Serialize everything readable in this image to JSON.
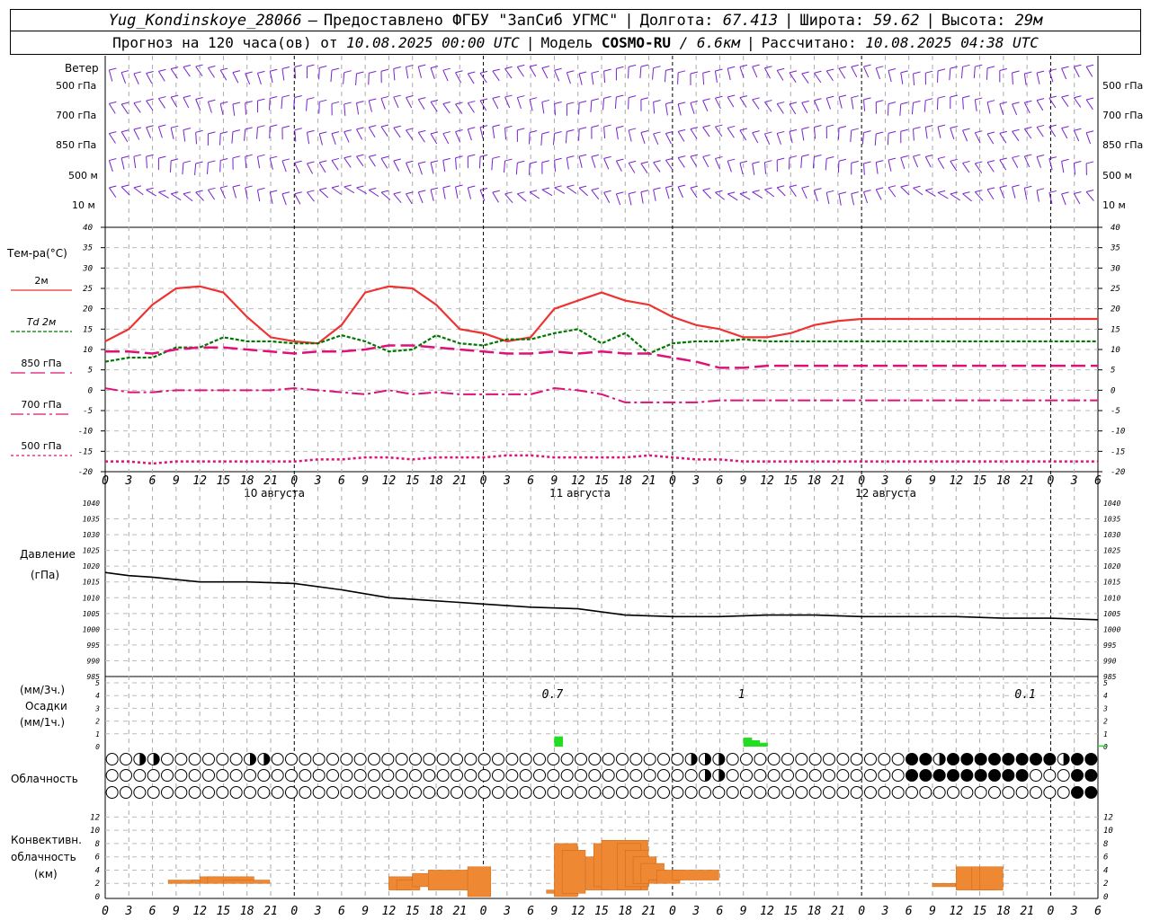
{
  "header": {
    "station": "Yug_Kondinskoye_28066",
    "dash": "–",
    "provided": "Предоставлено ФГБУ \"ЗапСиб УГМС\"",
    "lon_label": "Долгота:",
    "lon": "67.413",
    "lat_label": "Широта:",
    "lat": "59.62",
    "alt_label": "Высота:",
    "alt": "29м",
    "forecast_label": "Прогноз на 120 часа(ов) от",
    "forecast_date": "10.08.2025 00:00 UTC",
    "model_label": "Модель",
    "model": "COSMO-RU",
    "resolution": "/ 6.6км",
    "calc_label": "Рассчитано:",
    "calc_date": "10.08.2025 04:38 UTC"
  },
  "wind_panel": {
    "title": "Ветер",
    "levels": [
      "500 гПа",
      "700 гПа",
      "850 гПа",
      "500 м",
      "10 м"
    ]
  },
  "temp_panel": {
    "title": "Тем-ра(°C)",
    "legend": [
      {
        "label": "2м",
        "color": "#ee3333"
      },
      {
        "label": "Td  2м",
        "color": "#007700"
      },
      {
        "label": "850 гПа",
        "color": "#dd1177"
      },
      {
        "label": "700 гПа",
        "color": "#dd1177"
      },
      {
        "label": "500 гПа",
        "color": "#dd1177"
      }
    ]
  },
  "dates": [
    "10 августа",
    "11 августа",
    "12 августа"
  ],
  "pressure_panel": {
    "title1": "Давление",
    "title2": "(гПа)"
  },
  "precip_panel": {
    "title1": "(мм/3ч.)",
    "title2": "Осадки",
    "title3": "(мм/1ч.)",
    "annotations": [
      {
        "h": 57,
        "text": "0.7"
      },
      {
        "h": 81,
        "text": "1"
      },
      {
        "h": 117,
        "text": "0.1"
      }
    ]
  },
  "cloud_panel": {
    "title": "Облачность"
  },
  "conv_panel": {
    "title1": "Конвективн.",
    "title2": "облачность",
    "title3": "(км)"
  },
  "chart_data": [
    {
      "type": "line",
      "title": "Тем-ра(°C)",
      "x_hours": [
        0,
        3,
        6,
        9,
        12,
        15,
        18,
        21,
        24,
        27,
        30,
        33,
        36,
        39,
        42,
        45,
        48,
        51,
        54,
        57,
        60,
        63,
        66,
        69,
        72,
        75,
        78,
        81,
        84,
        87,
        90,
        93,
        96,
        99,
        102,
        105,
        108,
        111,
        114,
        117,
        120,
        123,
        126
      ],
      "ylim": [
        -20,
        40
      ],
      "series": [
        {
          "name": "2м",
          "values": [
            12,
            15,
            21,
            25,
            25.5,
            24,
            18,
            13,
            12,
            11.5,
            16,
            24,
            25.5,
            25,
            21,
            15,
            14,
            12,
            13,
            20,
            22,
            24,
            22,
            21,
            18,
            16,
            15,
            13,
            13,
            14,
            16,
            17,
            17.5,
            17.5,
            17.5,
            17.5,
            17.5,
            17.5,
            17.5,
            17.5,
            17.5,
            17.5,
            17.5
          ]
        },
        {
          "name": "Td 2м",
          "values": [
            7,
            8,
            8,
            10.5,
            10.5,
            13,
            12,
            12,
            11.5,
            11.5,
            13.5,
            12,
            9.5,
            10,
            13.5,
            11.5,
            11,
            12.5,
            12.5,
            14,
            15,
            11.5,
            14,
            9,
            11.5,
            12,
            12,
            12.5,
            12,
            12,
            12,
            12,
            12,
            12,
            12,
            12,
            12,
            12,
            12,
            12,
            12,
            12,
            12
          ]
        },
        {
          "name": "850 гПа",
          "values": [
            9.5,
            9.5,
            9,
            10,
            10.5,
            10.5,
            10,
            9.5,
            9,
            9.5,
            9.5,
            10,
            11,
            11,
            10.5,
            10,
            9.5,
            9,
            9,
            9.5,
            9,
            9.5,
            9,
            9,
            8,
            7,
            5.5,
            5.5,
            6,
            6,
            6,
            6,
            6,
            6,
            6,
            6,
            6,
            6,
            6,
            6,
            6,
            6,
            6
          ]
        },
        {
          "name": "700 гПа",
          "values": [
            0.5,
            -0.5,
            -0.5,
            0,
            0,
            0,
            0,
            0,
            0.5,
            0,
            -0.5,
            -1,
            0,
            -1,
            -0.5,
            -1,
            -1,
            -1,
            -1,
            0.5,
            0,
            -1,
            -3,
            -3,
            -3,
            -3,
            -2.5,
            -2.5,
            -2.5,
            -2.5,
            -2.5,
            -2.5,
            -2.5,
            -2.5,
            -2.5,
            -2.5,
            -2.5,
            -2.5,
            -2.5,
            -2.5,
            -2.5,
            -2.5,
            -2.5
          ]
        },
        {
          "name": "500 гПа",
          "values": [
            -17.5,
            -17.5,
            -18,
            -17.5,
            -17.5,
            -17.5,
            -17.5,
            -17.5,
            -17.5,
            -17,
            -17,
            -16.5,
            -16.5,
            -17,
            -16.5,
            -16.5,
            -16.5,
            -16,
            -16,
            -16.5,
            -16.5,
            -16.5,
            -16.5,
            -16,
            -16.5,
            -17,
            -17,
            -17.5,
            -17.5,
            -17.5,
            -17.5,
            -17.5,
            -17.5,
            -17.5,
            -17.5,
            -17.5,
            -17.5,
            -17.5,
            -17.5,
            -17.5,
            -17.5,
            -17.5,
            -17.5
          ]
        }
      ]
    },
    {
      "type": "line",
      "title": "Давление (гПа)",
      "x_hours": [
        0,
        3,
        6,
        12,
        18,
        24,
        30,
        36,
        42,
        48,
        54,
        60,
        66,
        72,
        78,
        84,
        90,
        96,
        102,
        108,
        114,
        120,
        126
      ],
      "ylim": [
        985,
        1040
      ],
      "series": [
        {
          "name": "Давление",
          "values": [
            1018,
            1017,
            1016.5,
            1015,
            1015,
            1014.5,
            1012.5,
            1010,
            1009,
            1008,
            1007,
            1006.5,
            1004.5,
            1004,
            1004,
            1004.5,
            1004.5,
            1004,
            1004,
            1004,
            1003.5,
            1003.5,
            1003
          ]
        }
      ]
    },
    {
      "type": "bar",
      "title": "Осадки",
      "ylim": [
        0,
        5
      ],
      "bars": [
        {
          "h": 57,
          "value": 0.8
        },
        {
          "h": 81,
          "value": 0.7
        },
        {
          "h": 82,
          "value": 0.5
        },
        {
          "h": 83,
          "value": 0.3
        },
        {
          "h": 126,
          "value": 0.1
        }
      ]
    },
    {
      "type": "bar",
      "title": "Конвективн. облачность (км)",
      "ylim": [
        0,
        13
      ],
      "bars": [
        {
          "h": 8,
          "w": 3,
          "bottom": 2,
          "top": 2.5
        },
        {
          "h": 11,
          "w": 1,
          "bottom": 2,
          "top": 2.5
        },
        {
          "h": 12,
          "w": 1,
          "bottom": 2,
          "top": 3
        },
        {
          "h": 13,
          "w": 2,
          "bottom": 2,
          "top": 3
        },
        {
          "h": 15,
          "w": 2,
          "bottom": 2,
          "top": 2.5
        },
        {
          "h": 36,
          "w": 1,
          "bottom": 1,
          "top": 3
        },
        {
          "h": 37,
          "w": 1,
          "bottom": 1,
          "top": 2.5
        },
        {
          "h": 39,
          "w": 2,
          "bottom": 1.5,
          "top": 3.5
        },
        {
          "h": 41,
          "w": 2,
          "bottom": 1,
          "top": 4
        },
        {
          "h": 46,
          "w": 1,
          "bottom": 0,
          "top": 4.5
        },
        {
          "h": 56,
          "w": 1,
          "bottom": 0.5,
          "top": 1
        },
        {
          "h": 57,
          "w": 1,
          "bottom": 0,
          "top": 8
        },
        {
          "h": 58,
          "w": 1,
          "bottom": 0.5,
          "top": 7
        },
        {
          "h": 61,
          "w": 1,
          "bottom": 1,
          "top": 6
        },
        {
          "h": 62,
          "w": 1,
          "bottom": 1.5,
          "top": 8
        },
        {
          "h": 63,
          "w": 2,
          "bottom": 1,
          "top": 8.5
        },
        {
          "h": 65,
          "w": 1,
          "bottom": 1,
          "top": 8
        },
        {
          "h": 66,
          "w": 1,
          "bottom": 1.5,
          "top": 7
        },
        {
          "h": 67,
          "w": 1,
          "bottom": 2,
          "top": 6
        },
        {
          "h": 68,
          "w": 1,
          "bottom": 2,
          "top": 5
        },
        {
          "h": 69,
          "w": 1,
          "bottom": 2,
          "top": 2.5
        },
        {
          "h": 70,
          "w": 1,
          "bottom": 2,
          "top": 4
        },
        {
          "h": 72,
          "w": 2,
          "bottom": 2.5,
          "top": 4
        },
        {
          "h": 105,
          "w": 1,
          "bottom": 1.5,
          "top": 2
        },
        {
          "h": 108,
          "w": 1,
          "bottom": 1,
          "top": 4.5
        },
        {
          "h": 110,
          "w": 1,
          "bottom": 1,
          "top": 4.5
        },
        {
          "h": 111,
          "w": 1,
          "bottom": 1,
          "top": 4.5
        }
      ]
    }
  ],
  "cloud_rows": [
    "0000055550000000000000000005555000000000000000000000000000000000000000000000000000000000000000000000000000000000000555555550000000000000000000000000000000055088888855888888888888888888888855588888888",
    "0000000000000000000000000000000000000000000000000000000000000000000000000000000000000000000000000000000000000000000000555555000000000000000000000000000000000000888888858888888888888888888000000008888888",
    "0000000000000000000000000000000000000000000000000000000000000000000000000000000000000000000000000000000000000000000000000000000000000000000000000000000000000000000000000000000000000000000008888888"
  ]
}
